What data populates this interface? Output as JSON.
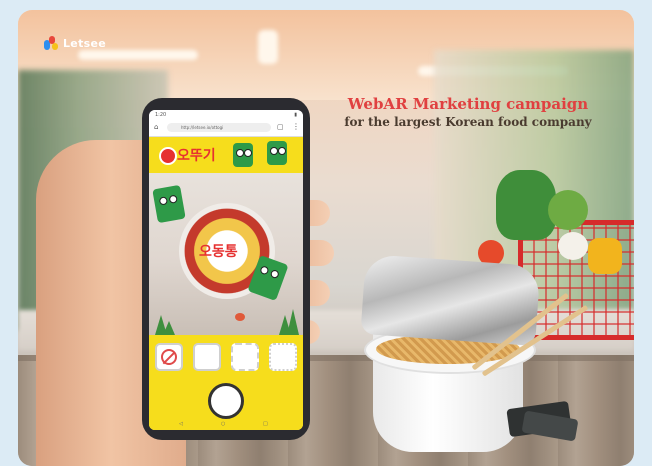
{
  "brand": {
    "logo_text": "Letsee"
  },
  "headline": {
    "line1": "WebAR Marketing campaign",
    "line2": "for the largest Korean food company"
  },
  "phone": {
    "status_time": "1:20",
    "url_text": "http://letsee.io/ottogi",
    "app_brand": "오뚜기",
    "cup_text": "오동통",
    "nav_back": "◁",
    "nav_home": "○",
    "nav_recent": "□"
  },
  "colors": {
    "headline_red": "#e04040",
    "brand_yellow": "#f6dd1c",
    "mascot_green": "#2e9a48",
    "cart_red": "#d62b2b"
  },
  "icons": [
    "letsee-logo-icon",
    "no-filter-icon",
    "shutter-button-icon",
    "menu-dots-icon"
  ]
}
